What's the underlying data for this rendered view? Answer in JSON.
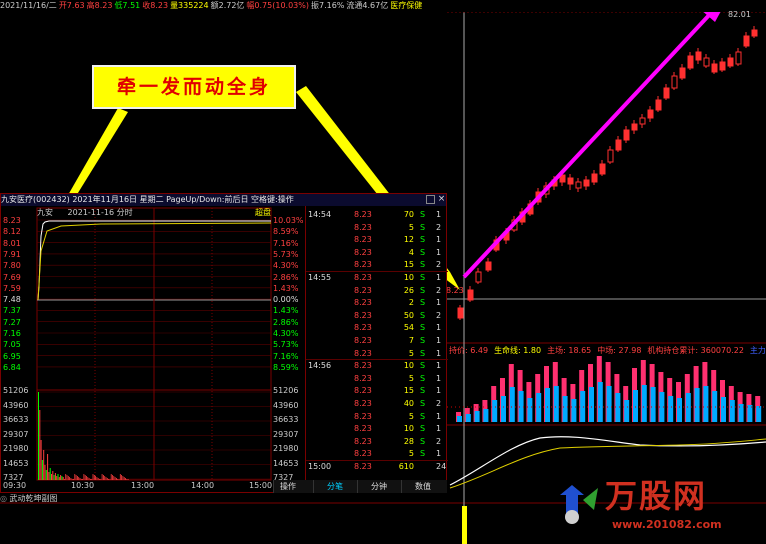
{
  "top_bar": [
    {
      "text": "2021/11/16/二",
      "color": "#cccccc"
    },
    {
      "text": "开7.63",
      "color": "#ff4040"
    },
    {
      "text": "高8.23",
      "color": "#ff4040"
    },
    {
      "text": "低7.51",
      "color": "#00ff00"
    },
    {
      "text": "收8.23",
      "color": "#ff4040"
    },
    {
      "text": "量335224",
      "color": "#ffff00"
    },
    {
      "text": "额2.72亿",
      "color": "#cccccc"
    },
    {
      "text": "幅0.75(10.03%)",
      "color": "#ff4040"
    },
    {
      "text": "振7.16%",
      "color": "#cccccc"
    },
    {
      "text": "流通4.67亿",
      "color": "#cccccc"
    },
    {
      "text": "医疗保健",
      "color": "#ffff00"
    }
  ],
  "kline": {
    "latest_value": "8.23",
    "high_label": "82.01"
  },
  "indicator_bar": [
    {
      "text": "持价: 6.49",
      "color": "#ff4040"
    },
    {
      "text": "生命线: 1.80",
      "color": "#ffff00"
    },
    {
      "text": "主场: 18.65",
      "color": "#ff4040"
    },
    {
      "text": "中场: 27.98",
      "color": "#ff4040"
    },
    {
      "text": "机构持仓累计: 360070.22",
      "color": "#ff4040"
    },
    {
      "text": "主力出入资金",
      "color": "#4060ff"
    }
  ],
  "callout": {
    "text": "牵一发而动全身"
  },
  "panel": {
    "title": "九安医疗(002432) 2021年11月16日 星期二 PageUp/Down:前后日 空格键:操作",
    "subtitle_name": "九安",
    "subtitle_date": "2021-11-16 分时",
    "subtitle_right": "超盘",
    "price_labels": [
      "8.23",
      "8.12",
      "8.01",
      "7.91",
      "7.80",
      "7.69",
      "7.59",
      "7.48",
      "7.37",
      "7.27",
      "7.16",
      "7.05",
      "6.95",
      "6.84"
    ],
    "pct_labels": [
      "10.03%",
      "8.59%",
      "7.16%",
      "5.73%",
      "4.30%",
      "2.86%",
      "1.43%",
      "0.00%",
      "1.43%",
      "2.86%",
      "4.30%",
      "5.73%",
      "7.16%",
      "8.59%"
    ],
    "volume_labels": [
      "51206",
      "43960",
      "36633",
      "29307",
      "21980",
      "14653",
      "7327"
    ],
    "time_labels": [
      "09:30",
      "10:30",
      "13:00",
      "14:00",
      "15:00"
    ],
    "ticks": [
      {
        "time": "14:54",
        "price": "8.23",
        "vol": "70",
        "side": "S",
        "n": "1"
      },
      {
        "time": "",
        "price": "8.23",
        "vol": "5",
        "side": "S",
        "n": "2"
      },
      {
        "time": "",
        "price": "8.23",
        "vol": "12",
        "side": "S",
        "n": "1"
      },
      {
        "time": "",
        "price": "8.23",
        "vol": "4",
        "side": "S",
        "n": "1"
      },
      {
        "time": "",
        "price": "8.23",
        "vol": "15",
        "side": "S",
        "n": "2"
      },
      {
        "time": "14:55",
        "price": "8.23",
        "vol": "10",
        "side": "S",
        "n": "1"
      },
      {
        "time": "",
        "price": "8.23",
        "vol": "26",
        "side": "S",
        "n": "2"
      },
      {
        "time": "",
        "price": "8.23",
        "vol": "2",
        "side": "S",
        "n": "1"
      },
      {
        "time": "",
        "price": "8.23",
        "vol": "50",
        "side": "S",
        "n": "2"
      },
      {
        "time": "",
        "price": "8.23",
        "vol": "54",
        "side": "S",
        "n": "1"
      },
      {
        "time": "",
        "price": "8.23",
        "vol": "7",
        "side": "S",
        "n": "1"
      },
      {
        "time": "",
        "price": "8.23",
        "vol": "5",
        "side": "S",
        "n": "1"
      },
      {
        "time": "14:56",
        "price": "8.23",
        "vol": "10",
        "side": "S",
        "n": "1"
      },
      {
        "time": "",
        "price": "8.23",
        "vol": "5",
        "side": "S",
        "n": "1"
      },
      {
        "time": "",
        "price": "8.23",
        "vol": "15",
        "side": "S",
        "n": "1"
      },
      {
        "time": "",
        "price": "8.23",
        "vol": "40",
        "side": "S",
        "n": "2"
      },
      {
        "time": "",
        "price": "8.23",
        "vol": "5",
        "side": "S",
        "n": "1"
      },
      {
        "time": "",
        "price": "8.23",
        "vol": "10",
        "side": "S",
        "n": "1"
      },
      {
        "time": "",
        "price": "8.23",
        "vol": "28",
        "side": "S",
        "n": "2"
      },
      {
        "time": "",
        "price": "8.23",
        "vol": "5",
        "side": "S",
        "n": "1"
      },
      {
        "time": "15:00",
        "price": "8.23",
        "vol": "610",
        "side": "",
        "n": "24"
      }
    ],
    "tabs": [
      "操作",
      "分笔",
      "分钟",
      "数值"
    ]
  },
  "bottom_label": "武动乾坤副图",
  "watermark": {
    "logo": "万股网",
    "url": "www.201082.com"
  }
}
